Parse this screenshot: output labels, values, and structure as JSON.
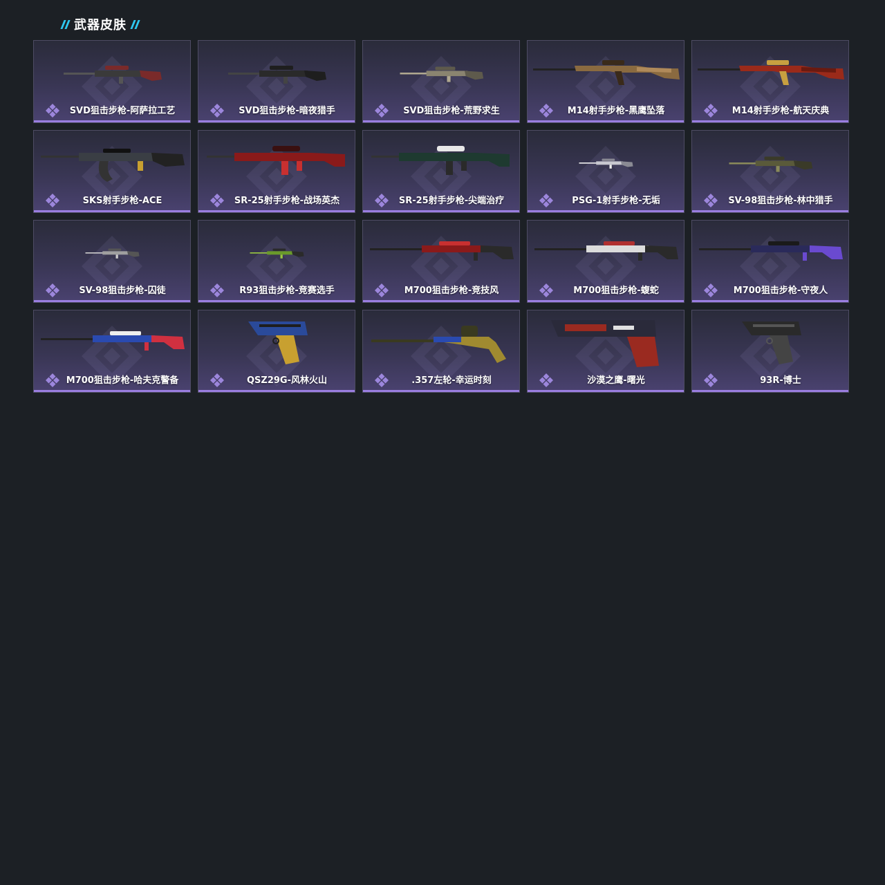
{
  "section": {
    "title": "武器皮肤"
  },
  "colors": {
    "page_bg": "#1c2025",
    "accent_cyan": "#2ec8f0",
    "card_bottom_bar": "#9a7ee0",
    "quality_icon": "#9c86dc"
  },
  "skins": [
    {
      "label": "SVD狙击步枪-阿萨拉工艺",
      "type": "sniper",
      "palette": [
        "#3a3a3a",
        "#7a2a2a",
        "#555"
      ]
    },
    {
      "label": "SVD狙击步枪-暗夜猎手",
      "type": "sniper",
      "palette": [
        "#2a2a2a",
        "#1e1e1e",
        "#444"
      ]
    },
    {
      "label": "SVD狙击步枪-荒野求生",
      "type": "sniper-small",
      "palette": [
        "#8a8470",
        "#5e5a4c",
        "#b0a890"
      ]
    },
    {
      "label": "M14射手步枪-黑鹰坠落",
      "type": "rifle-long",
      "palette": [
        "#8a6a40",
        "#3a2a1a",
        "#b08a5a"
      ]
    },
    {
      "label": "M14射手步枪-航天庆典",
      "type": "rifle-long",
      "palette": [
        "#9a2a1a",
        "#c8a040",
        "#6a1a10"
      ]
    },
    {
      "label": "SKS射手步枪-ACE",
      "type": "ak",
      "palette": [
        "#3a3e44",
        "#c8a030",
        "#222"
      ]
    },
    {
      "label": "SR-25射手步枪-战场英杰",
      "type": "ar",
      "palette": [
        "#8a1a1a",
        "#3a1010",
        "#c83030"
      ]
    },
    {
      "label": "SR-25射手步枪-尖端治疗",
      "type": "ar",
      "palette": [
        "#1e3a30",
        "#e8e8e8",
        "#2a2a2a"
      ]
    },
    {
      "label": "PSG-1射手步枪-无垢",
      "type": "sniper-tiny",
      "palette": [
        "#c8c8d0",
        "#8a8a94",
        "#eee"
      ]
    },
    {
      "label": "SV-98狙击步枪-林中猎手",
      "type": "sniper-small",
      "palette": [
        "#5a5a3a",
        "#3a3a28",
        "#8a8a5a"
      ]
    },
    {
      "label": "SV-98狙击步枪-囚徒",
      "type": "sniper-tiny",
      "palette": [
        "#a0a0a0",
        "#555",
        "#ccc"
      ]
    },
    {
      "label": "R93狙击步枪-竞赛选手",
      "type": "sniper-tiny",
      "palette": [
        "#6a9a2a",
        "#2a2a2a",
        "#9ac840"
      ]
    },
    {
      "label": "M700狙击步枪-竞技风",
      "type": "bolt",
      "palette": [
        "#8a1a1a",
        "#2a2a2a",
        "#c83030"
      ]
    },
    {
      "label": "M700狙击步枪-蝮蛇",
      "type": "bolt",
      "palette": [
        "#dcdcdc",
        "#2a2a2a",
        "#b03030"
      ]
    },
    {
      "label": "M700狙击步枪-守夜人",
      "type": "bolt",
      "palette": [
        "#2a2a5a",
        "#6a4ad0",
        "#1a1a1a"
      ]
    },
    {
      "label": "M700狙击步枪-哈夫克警备",
      "type": "bolt",
      "palette": [
        "#2a4ab0",
        "#d03040",
        "#eee"
      ]
    },
    {
      "label": "QSZ29G-风林火山",
      "type": "pistol",
      "palette": [
        "#2a4a9a",
        "#c8a030",
        "#1e1e1e"
      ]
    },
    {
      "label": ".357左轮-幸运时刻",
      "type": "revolver",
      "palette": [
        "#a08a30",
        "#3a3a20",
        "#2a4ab0"
      ]
    },
    {
      "label": "沙漠之鹰-曙光",
      "type": "deagle",
      "palette": [
        "#9a2a20",
        "#2a2a3a",
        "#e0e0e0"
      ]
    },
    {
      "label": "93R-博士",
      "type": "pistol",
      "palette": [
        "#2a2a2a",
        "#444",
        "#555"
      ]
    }
  ]
}
